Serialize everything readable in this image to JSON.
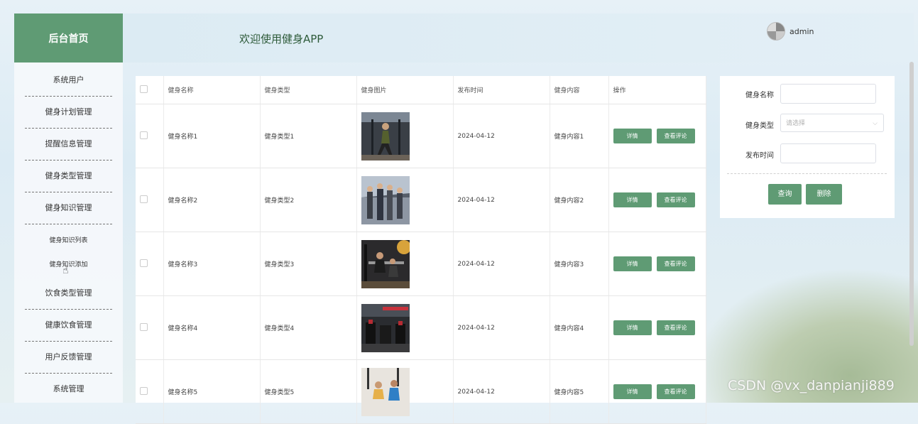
{
  "sidebar": {
    "title": "后台首页",
    "items": [
      {
        "label": "系统用户"
      },
      {
        "label": "健身计划管理"
      },
      {
        "label": "提醒信息管理"
      },
      {
        "label": "健身类型管理"
      },
      {
        "label": "健身知识管理"
      },
      {
        "label": "健身知识列表"
      },
      {
        "label": "健身知识添加"
      },
      {
        "label": "饮食类型管理"
      },
      {
        "label": "健康饮食管理"
      },
      {
        "label": "用户反馈管理"
      },
      {
        "label": "系统管理"
      }
    ]
  },
  "header": {
    "welcome": "欢迎使用健身APP",
    "username": "admin"
  },
  "table": {
    "columns": [
      "健身名称",
      "健身类型",
      "健身图片",
      "发布时间",
      "健身内容",
      "操作"
    ],
    "rows": [
      {
        "name": "健身名称1",
        "type": "健身类型1",
        "date": "2024-04-12",
        "content": "健身内容1"
      },
      {
        "name": "健身名称2",
        "type": "健身类型2",
        "date": "2024-04-12",
        "content": "健身内容2"
      },
      {
        "name": "健身名称3",
        "type": "健身类型3",
        "date": "2024-04-12",
        "content": "健身内容3"
      },
      {
        "name": "健身名称4",
        "type": "健身类型4",
        "date": "2024-04-12",
        "content": "健身内容4"
      },
      {
        "name": "健身名称5",
        "type": "健身类型5",
        "date": "2024-04-12",
        "content": "健身内容5"
      }
    ],
    "actions": {
      "detail": "详情",
      "review": "查看评论"
    }
  },
  "filter": {
    "name_label": "健身名称",
    "type_label": "健身类型",
    "type_placeholder": "请选择",
    "date_label": "发布时间",
    "query_label": "查询",
    "delete_label": "删除"
  },
  "watermark": "CSDN @vx_danpianji889",
  "colors": {
    "accent": "#5f9b74"
  }
}
